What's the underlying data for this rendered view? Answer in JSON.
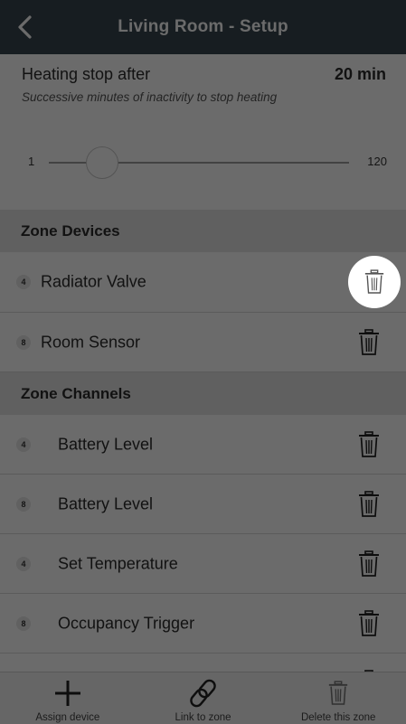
{
  "header": {
    "title": "Living Room - Setup",
    "back_icon": "chevron-left-icon"
  },
  "heating": {
    "label": "Heating stop after",
    "value": "20 min",
    "description": "Successive minutes of inactivity to stop heating",
    "slider": {
      "min": "1",
      "max": "120",
      "current": 20
    }
  },
  "zone_devices": {
    "title": "Zone Devices",
    "items": [
      {
        "badge": "4",
        "label": "Radiator Valve"
      },
      {
        "badge": "8",
        "label": "Room Sensor"
      }
    ]
  },
  "zone_channels": {
    "title": "Zone Channels",
    "items": [
      {
        "badge": "4",
        "label": "Battery Level"
      },
      {
        "badge": "8",
        "label": "Battery Level"
      },
      {
        "badge": "4",
        "label": "Set Temperature"
      },
      {
        "badge": "8",
        "label": "Occupancy Trigger"
      }
    ]
  },
  "bottom_bar": {
    "assign": {
      "label": "Assign device",
      "icon": "plus-icon"
    },
    "link": {
      "label": "Link to zone",
      "icon": "link-icon"
    },
    "delete": {
      "label": "Delete this zone",
      "icon": "trash-icon"
    }
  },
  "colors": {
    "header_bg": "#37474f",
    "section_bg": "#e4e4e4",
    "overlay": "rgba(0,0,0,0.58)"
  }
}
